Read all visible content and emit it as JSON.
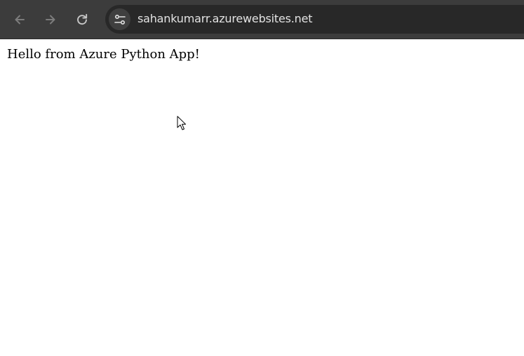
{
  "browser": {
    "toolbar_bg": "#3c3c3c",
    "buttons": {
      "back": "back-arrow-icon",
      "forward": "forward-arrow-icon",
      "reload": "reload-icon",
      "site_info": "tune-icon"
    },
    "address_bar": {
      "url": "sahankumarr.azurewebsites.net"
    }
  },
  "page": {
    "body_text": "Hello from Azure Python App!"
  },
  "cursor": {
    "icon": "mouse-pointer-icon"
  }
}
